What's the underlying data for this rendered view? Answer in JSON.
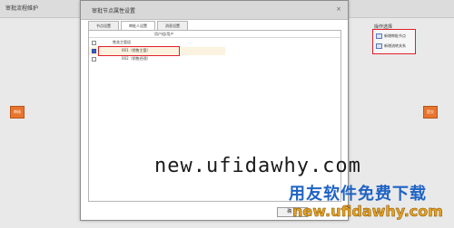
{
  "background_window": {
    "title": "审批流程维护",
    "left_button_label": "审核",
    "right_button_label": "提交"
  },
  "operations_panel": {
    "title": "操作选择",
    "items": [
      {
        "label": "新增审批节点",
        "icon": "node-add-icon"
      },
      {
        "label": "新增流转关系",
        "icon": "flow-link-icon"
      }
    ]
  },
  "dialog": {
    "title": "审批节点属性设置",
    "close_glyph": "×",
    "tabs": [
      {
        "label": "节点设置",
        "active": false
      },
      {
        "label": "审批人设置",
        "active": true
      },
      {
        "label": "消息设置",
        "active": false
      }
    ],
    "table_header": "用户组/用户",
    "rows": [
      {
        "label": "售卖主管组",
        "checked": false
      },
      {
        "label": "001（销售主管）",
        "checked": true
      },
      {
        "label": "002（销售经理）",
        "checked": false
      }
    ],
    "ok_button": "确 定"
  },
  "watermark": {
    "url": "new.ufidawhy.com",
    "brand": "用友软件免费下载",
    "url_bottom": "new.ufidawhy.com"
  },
  "colors": {
    "accent_orange": "#e8752e",
    "highlight_red": "#e0202a",
    "watermark_blue": "#1f63c4",
    "watermark_gold": "#e8a320"
  }
}
